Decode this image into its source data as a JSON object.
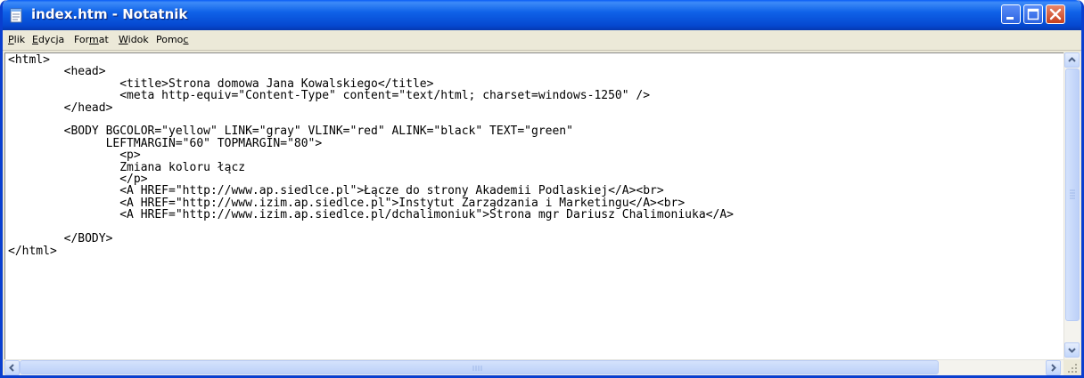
{
  "window": {
    "title": "index.htm - Notatnik",
    "app_icon": "notepad-icon",
    "controls": [
      "minimize-icon",
      "maximize-icon",
      "close-icon"
    ]
  },
  "menu": {
    "items": [
      {
        "pre": "",
        "key": "P",
        "post": "lik"
      },
      {
        "pre": "",
        "key": "E",
        "post": "dycja"
      },
      {
        "pre": "For",
        "key": "m",
        "post": "at"
      },
      {
        "pre": "",
        "key": "W",
        "post": "idok"
      },
      {
        "pre": "Pomo",
        "key": "c",
        "post": ""
      }
    ]
  },
  "editor": {
    "lines": [
      "<html>",
      "        <head>",
      "                <title>Strona domowa Jana Kowalskiego</title>",
      "                <meta http-equiv=\"Content-Type\" content=\"text/html; charset=windows-1250\" />",
      "        </head>",
      "",
      "        <BODY BGCOLOR=\"yellow\" LINK=\"gray\" VLINK=\"red\" ALINK=\"black\" TEXT=\"green\"",
      "              LEFTMARGIN=\"60\" TOPMARGIN=\"80\">",
      "                <p>",
      "                Zmiana koloru łącz",
      "                </p>",
      "                <A HREF=\"http://www.ap.siedlce.pl\">Łącze do strony Akademii Podlaskiej</A><br>",
      "                <A HREF=\"http://www.izim.ap.siedlce.pl\">Instytut Zarządzania i Marketingu</A><br>",
      "                <A HREF=\"http://www.izim.ap.siedlce.pl/dchalimoniuk\">Strona mgr Dariusz Chalimoniuka</A>",
      "",
      "        </BODY>",
      "</html>"
    ]
  },
  "colors": {
    "titlebar": "#0a5cf5",
    "menubar": "#ece9d8",
    "close_button": "#c6401e"
  }
}
